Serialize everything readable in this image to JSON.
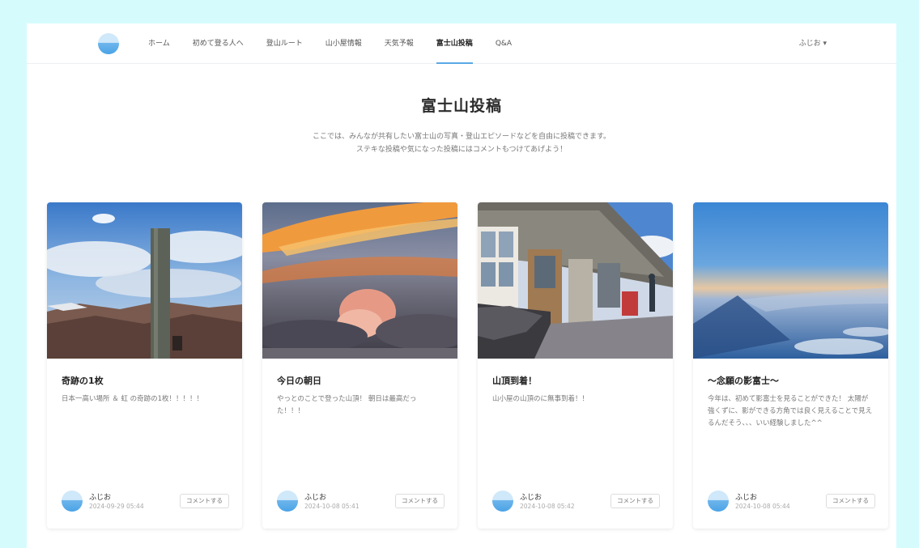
{
  "nav": {
    "items": [
      {
        "label": "ホーム",
        "active": false
      },
      {
        "label": "初めて登る人へ",
        "active": false
      },
      {
        "label": "登山ルート",
        "active": false
      },
      {
        "label": "山小屋情報",
        "active": false
      },
      {
        "label": "天気予報",
        "active": false
      },
      {
        "label": "富士山投稿",
        "active": true
      },
      {
        "label": "Q&A",
        "active": false
      }
    ],
    "user_label": "ふじお ▾"
  },
  "page": {
    "title": "富士山投稿",
    "desc_line1": "ここでは、みんなが共有したい富士山の写真・登山エピソードなどを自由に投稿できます。",
    "desc_line2": "ステキな投稿や気になった投稿にはコメントもつけてあげよう！"
  },
  "posts": [
    {
      "title": "奇跡の1枚",
      "text": "日本一高い場所 ＆ 虹 の奇跡の1枚！！！！！",
      "author": "ふじお",
      "date": "2024-09-29 05:44",
      "comment_label": "コメントする"
    },
    {
      "title": "今日の朝日",
      "text": "やっとのことで登った山頂！ 朝日は最高だった！！！",
      "author": "ふじお",
      "date": "2024-10-08 05:41",
      "comment_label": "コメントする"
    },
    {
      "title": "山頂到着！",
      "text": "山小屋の山頂のに無事到着！！",
      "author": "ふじお",
      "date": "2024-10-08 05:42",
      "comment_label": "コメントする"
    },
    {
      "title": "〜念願の影富士〜",
      "text": "今年は、初めて影富士を見ることができた！ 太陽が強くずに、影ができる方角では良く見えることで見えるんだそう、、、いい経験しました^^",
      "author": "ふじお",
      "date": "2024-10-08 05:44",
      "comment_label": "コメントする"
    }
  ],
  "colors": {
    "accent": "#5aa9e6",
    "page_bg": "#d6fbfd"
  }
}
